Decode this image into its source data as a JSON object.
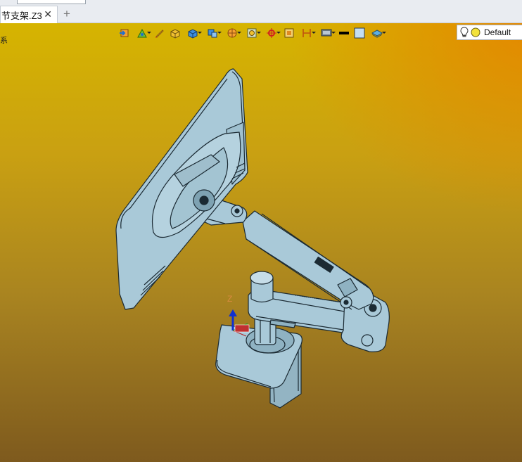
{
  "document_tab": {
    "label": "节支架.Z3",
    "close_glyph": "✕",
    "add_glyph": "+"
  },
  "viewport": {
    "side_char": "系",
    "triad": {
      "z_label": "Z"
    }
  },
  "toolbar": {
    "buttons": [
      {
        "icon": "exit-icon"
      },
      {
        "icon": "sketch-icon",
        "dropdown": true
      },
      {
        "icon": "pencil-icon"
      },
      {
        "icon": "yellow-box-icon"
      },
      {
        "icon": "blue-box-icon",
        "dropdown": true
      },
      {
        "icon": "view-cube-icon",
        "dropdown": true
      },
      {
        "icon": "section-icon",
        "dropdown": true
      },
      {
        "icon": "zoom-fit-icon",
        "dropdown": true
      },
      {
        "icon": "snap-icon",
        "dropdown": true
      },
      {
        "icon": "frame-icon"
      },
      {
        "icon": "dimension-icon",
        "dropdown": true
      },
      {
        "icon": "display-icon",
        "dropdown": true
      },
      {
        "icon": "black-line-icon"
      },
      {
        "icon": "light-blue-box-icon"
      },
      {
        "icon": "layer-icon",
        "dropdown": true
      }
    ],
    "style_label": "Default"
  },
  "colors": {
    "model_fill": "#a9c9d8",
    "model_edge": "#1b2a33",
    "bg_top": "#d6b400",
    "bg_bottom": "#7e5a1e",
    "bg_hot": "#e68200"
  }
}
